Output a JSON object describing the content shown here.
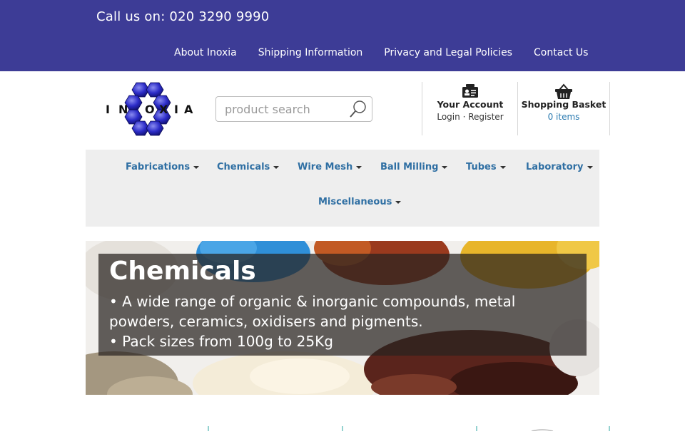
{
  "topbar": {
    "call_us": "Call us on: 020 3290 9990",
    "links": [
      "About Inoxia",
      "Shipping Information",
      "Privacy and Legal Policies",
      "Contact Us"
    ]
  },
  "logo": {
    "text": "INOXIA"
  },
  "search": {
    "placeholder": "product search",
    "icon": "search-icon"
  },
  "account": {
    "title": "Your Account",
    "login": "Login",
    "separator": "·",
    "register": "Register",
    "icon": "id-card-icon"
  },
  "basket": {
    "title": "Shopping Basket",
    "items": "0 items",
    "icon": "basket-icon"
  },
  "nav": {
    "items": [
      "Fabrications",
      "Chemicals",
      "Wire Mesh",
      "Ball Milling",
      "Tubes",
      "Laboratory",
      "Miscellaneous"
    ]
  },
  "banner": {
    "title": "Chemicals",
    "lines": [
      "• A wide range of organic & inorganic compounds, metal",
      "powders, ceramics, oxidisers and pigments.",
      "• Pack sizes from 100g to 25Kg"
    ]
  },
  "colors": {
    "topbar": "#3d3c96",
    "nav_link": "#2f6fa3",
    "nav_bg": "#eeeeee"
  }
}
